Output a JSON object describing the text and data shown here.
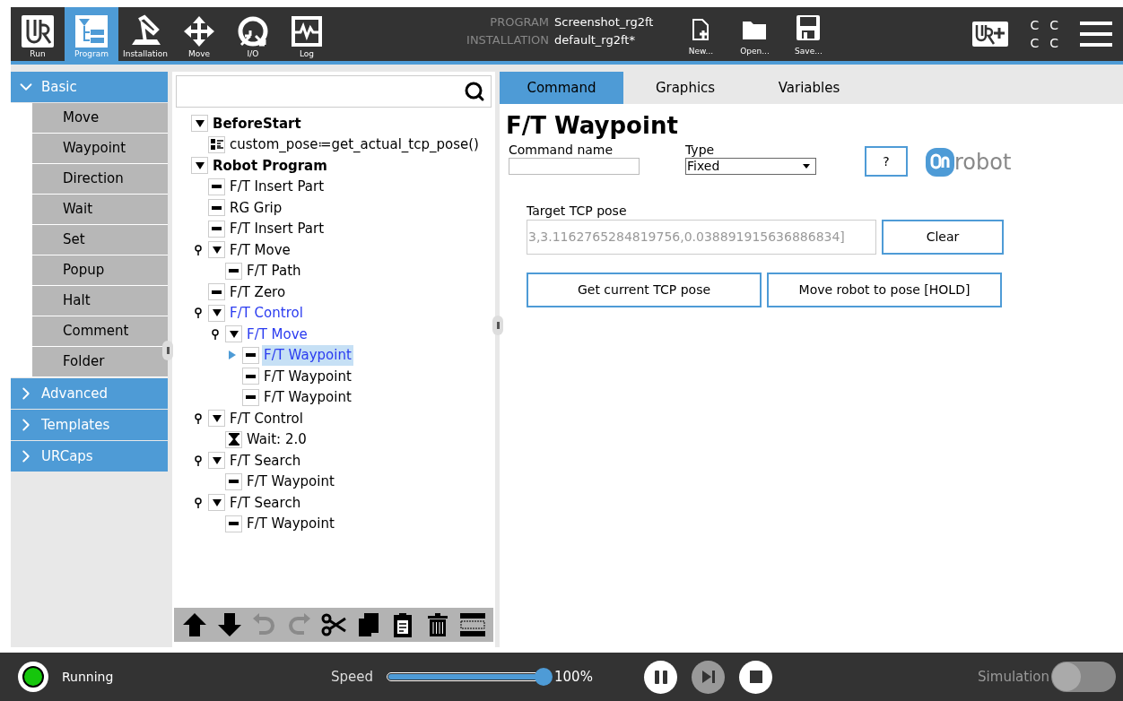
{
  "header": {
    "nav": [
      {
        "label": "Run",
        "selected": false
      },
      {
        "label": "Program",
        "selected": true
      },
      {
        "label": "Installation",
        "selected": false
      },
      {
        "label": "Move",
        "selected": false
      },
      {
        "label": "I/O",
        "selected": false
      },
      {
        "label": "Log",
        "selected": false
      }
    ],
    "program_label": "PROGRAM",
    "program_name": "Screenshot_rg2ft",
    "installation_label": "INSTALLATION",
    "installation_name": "default_rg2ft*",
    "file_buttons": [
      "New...",
      "Open...",
      "Save..."
    ],
    "status_letters": [
      "C",
      "C",
      "C",
      "C"
    ]
  },
  "sidebar": [
    {
      "label": "Basic",
      "expanded": true,
      "items": [
        "Move",
        "Waypoint",
        "Direction",
        "Wait",
        "Set",
        "Popup",
        "Halt",
        "Comment",
        "Folder"
      ]
    },
    {
      "label": "Advanced",
      "expanded": false
    },
    {
      "label": "Templates",
      "expanded": false
    },
    {
      "label": "URCaps",
      "expanded": false
    }
  ],
  "tree": [
    {
      "label": "BeforeStart",
      "kind": "section",
      "active": false,
      "selected": false,
      "expanded": true,
      "children": [
        {
          "label": "custom_pose≔get_actual_tcp_pose()",
          "kind": "assignment",
          "active": false,
          "selected": false
        }
      ]
    },
    {
      "label": "Robot Program",
      "kind": "section",
      "active": false,
      "selected": false,
      "expanded": true,
      "children": [
        {
          "label": "F/T Insert Part",
          "kind": "command",
          "active": false,
          "selected": false
        },
        {
          "label": "RG Grip",
          "kind": "command",
          "active": false,
          "selected": false
        },
        {
          "label": "F/T Insert Part",
          "kind": "command",
          "active": false,
          "selected": false
        },
        {
          "label": "F/T Move",
          "kind": "command",
          "active": false,
          "selected": false,
          "expanded": true,
          "children": [
            {
              "label": "F/T Path",
              "kind": "command",
              "active": false,
              "selected": false
            }
          ]
        },
        {
          "label": "F/T Zero",
          "kind": "command",
          "active": false,
          "selected": false
        },
        {
          "label": "F/T Control",
          "kind": "command",
          "active": true,
          "selected": false,
          "expanded": true,
          "children": [
            {
              "label": "F/T Move",
              "kind": "command",
              "active": true,
              "selected": false,
              "expanded": true,
              "children": [
                {
                  "label": "F/T Waypoint",
                  "kind": "command",
                  "active": true,
                  "selected": true
                },
                {
                  "label": "F/T Waypoint",
                  "kind": "command",
                  "active": false,
                  "selected": false
                },
                {
                  "label": "F/T Waypoint",
                  "kind": "command",
                  "active": false,
                  "selected": false
                }
              ]
            }
          ]
        },
        {
          "label": "F/T Control",
          "kind": "command",
          "active": false,
          "selected": false,
          "expanded": true,
          "children": [
            {
              "label": "Wait: 2.0",
              "kind": "wait",
              "active": false,
              "selected": false
            }
          ]
        },
        {
          "label": "F/T Search",
          "kind": "command",
          "active": false,
          "selected": false,
          "expanded": true,
          "children": [
            {
              "label": "F/T Waypoint",
              "kind": "command",
              "active": false,
              "selected": false
            }
          ]
        },
        {
          "label": "F/T Search",
          "kind": "command",
          "active": false,
          "selected": false,
          "expanded": true,
          "children": [
            {
              "label": "F/T Waypoint",
              "kind": "command",
              "active": false,
              "selected": false
            }
          ]
        }
      ]
    }
  ],
  "toolbar": [
    {
      "disabled": false
    },
    {
      "disabled": false
    },
    {
      "disabled": true
    },
    {
      "disabled": true
    },
    {
      "disabled": false
    },
    {
      "disabled": false
    },
    {
      "disabled": false
    },
    {
      "disabled": false
    },
    {
      "disabled": false
    }
  ],
  "tabs": [
    {
      "label": "Command",
      "selected": true
    },
    {
      "label": "Graphics",
      "selected": false
    },
    {
      "label": "Variables",
      "selected": false
    }
  ],
  "command": {
    "title": "F/T Waypoint",
    "command_name_label": "Command name",
    "type_label": "Type",
    "type_value": "Fixed",
    "help_button": "?",
    "logo_text": "robot",
    "target_label": "Target TCP pose",
    "target_value": "3,3.1162765284819756,0.038891915636886834]",
    "clear_button": "Clear",
    "buttons": [
      "Get current TCP pose",
      "Move robot to pose [HOLD]"
    ]
  },
  "footer": {
    "status": "Running",
    "running": true,
    "speed_label": "Speed",
    "speed": {
      "level": 1
    },
    "speed_reading": "100%",
    "controls": [
      {
        "disabled": false
      },
      {
        "disabled": true
      },
      {
        "disabled": false
      }
    ],
    "simulation_label": "Simulation",
    "simulation_on": false
  }
}
